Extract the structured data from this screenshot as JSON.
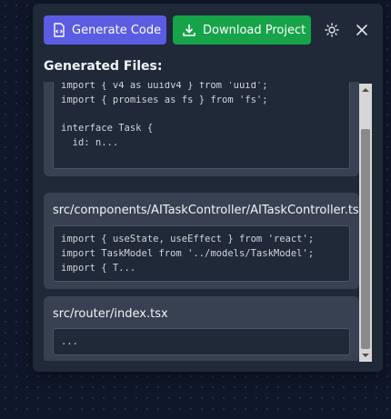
{
  "toolbar": {
    "generate_label": "Generate Code",
    "download_label": "Download Project",
    "generate_icon": "file-code-icon",
    "download_icon": "download-icon",
    "theme_icon": "sun-icon",
    "close_icon": "close-icon"
  },
  "section_title": "Generated Files:",
  "files": [
    {
      "name": "",
      "code": "import { v4 as uuidv4 } from 'uuid';\nimport { promises as fs } from 'fs';\n\ninterface Task {\n  id: n..."
    },
    {
      "name": "src/components/AITaskController/AITaskController.tsx",
      "code": "import { useState, useEffect } from 'react';\nimport TaskModel from '../models/TaskModel';\nimport { T..."
    },
    {
      "name": "src/router/index.tsx",
      "code": "..."
    }
  ],
  "colors": {
    "generate_button": "#5b5ce2",
    "download_button": "#16a34a",
    "panel": "#1f2937",
    "card": "#374151"
  }
}
